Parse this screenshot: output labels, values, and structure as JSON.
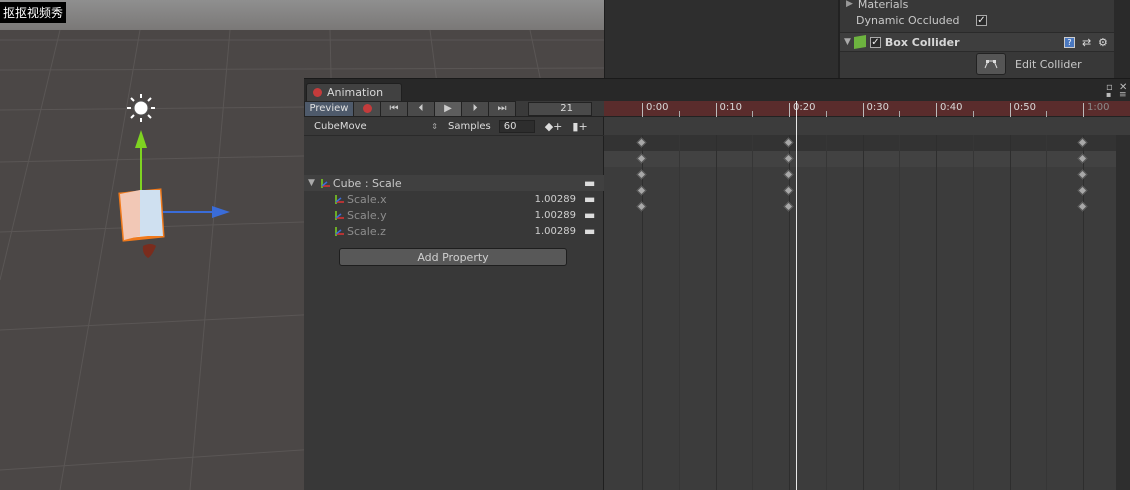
{
  "watermark": "抠抠视频秀",
  "inspector": {
    "materials_label": "Materials",
    "dynamic_occluded_label": "Dynamic Occluded",
    "dynamic_occluded_checked": true,
    "component_title": "Box Collider",
    "component_enabled": true,
    "edit_collider_label": "Edit Collider"
  },
  "animation": {
    "tab_title": "Animation",
    "toolbar": {
      "preview_label": "Preview",
      "frame": "21"
    },
    "clip": {
      "name": "CubeMove",
      "samples_label": "Samples",
      "samples": "60"
    },
    "properties": [
      {
        "label": "Cube : Scale",
        "value": "",
        "kind": "parent"
      },
      {
        "label": "Scale.x",
        "value": "1.00289",
        "kind": "child"
      },
      {
        "label": "Scale.y",
        "value": "1.00289",
        "kind": "child"
      },
      {
        "label": "Scale.z",
        "value": "1.00289",
        "kind": "child"
      }
    ],
    "add_property_label": "Add Property",
    "timeline": {
      "ticks": [
        "0:00",
        "0:10",
        "0:20",
        "0:30",
        "0:40",
        "0:50",
        "1:00"
      ],
      "playhead_frame": 21,
      "keyframes": [
        0,
        20,
        60
      ]
    }
  },
  "colors": {
    "record": "#c43b3b",
    "ruler": "#5a2c2c",
    "y_axis_gizmo": "#7ed321",
    "x_axis_gizmo": "#3a6cd8",
    "selection_outline": "#f07a1c"
  }
}
